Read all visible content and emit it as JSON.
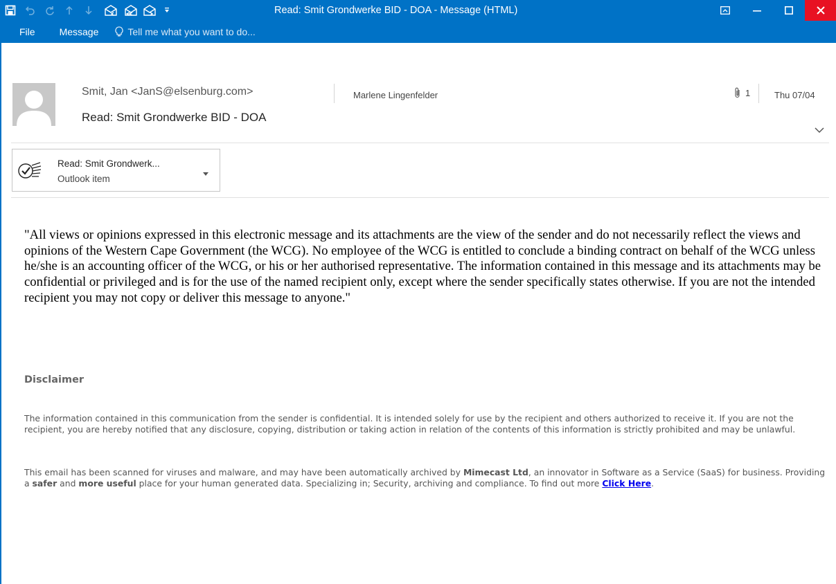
{
  "window": {
    "title": "Read: Smit Grondwerke BID - DOA - Message (HTML)"
  },
  "ribbon": {
    "tabs": [
      {
        "label": "File"
      },
      {
        "label": "Message"
      }
    ],
    "tell_me_placeholder": "Tell me what you want to do..."
  },
  "header": {
    "sender": "Smit, Jan <JanS@elsenburg.com>",
    "recipient": "Marlene Lingenfelder",
    "attachment_count": "1",
    "date": "Thu 07/04",
    "subject": "Read: Smit Grondwerke BID - DOA"
  },
  "attachment": {
    "name": "Read: Smit Grondwerk...",
    "type": "Outlook item"
  },
  "body": {
    "quote": "\"All views or opinions expressed in this electronic message and its attachments are the view of the sender and do not necessarily reflect the views and opinions of the Western Cape Government (the WCG). No employee of the WCG is entitled to conclude a binding contract on behalf of the WCG unless he/she is an accounting officer of the WCG, or his or her authorised representative. The information contained in this message and its attachments may be confidential or privileged and is for the use of the named recipient only, except where the sender specifically states otherwise. If you are not the intended recipient you may not copy or deliver this message to anyone.\"",
    "disclaimer_heading": "Disclaimer",
    "disclaimer_text": "The information contained in this communication from the sender is confidential. It is intended solely for use by the recipient and others authorized to receive it. If you are not the recipient, you are hereby notified that any disclosure, copying, distribution or taking action in relation of the contents of this information is strictly prohibited and may be unlawful.",
    "scan_part1": "This email has been scanned for viruses and malware, and may have been automatically archived by ",
    "scan_bold1": "Mimecast Ltd",
    "scan_part2": ", an innovator in Software as a Service (SaaS) for business. Providing a ",
    "scan_bold2": "safer",
    "scan_part3": " and ",
    "scan_bold3": "more useful",
    "scan_part4": " place for your human generated data. Specializing in; Security, archiving and compliance. To find out more ",
    "scan_link": "Click Here",
    "scan_end": "."
  },
  "colors": {
    "titlebar": "#0072c6",
    "close_button": "#e81123",
    "link": "#0000ee"
  }
}
